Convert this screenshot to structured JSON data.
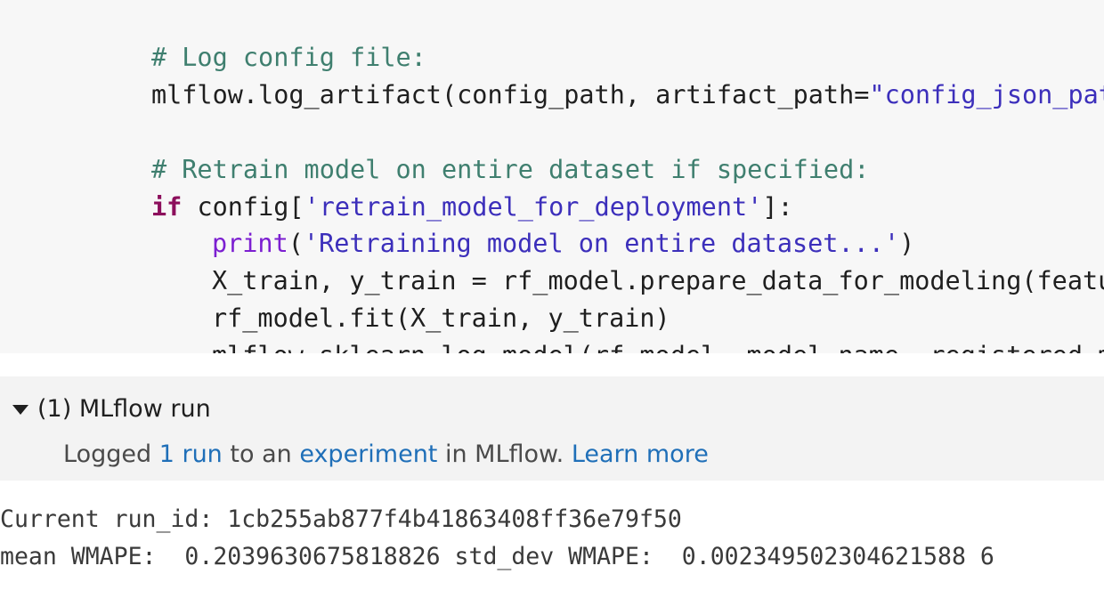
{
  "code": {
    "line1_comment": "# Log config file:",
    "line2_obj": "mlflow.log_artifact(config_path, artifact_path=",
    "line2_str": "\"config_json_path\"",
    "line2_end": ")",
    "line4_comment": "# Retrain model on entire dataset if specified:",
    "line5_kw": "if",
    "line5_a": " config[",
    "line5_str": "'retrain_model_for_deployment'",
    "line5_b": "]:",
    "line6_builtin": "print",
    "line6_a": "(",
    "line6_str": "'Retraining model on entire dataset...'",
    "line6_b": ")",
    "line7": "X_train, y_train = rf_model.prepare_data_for_modeling(features_ut",
    "line8": "rf_model.fit(X_train, y_train)",
    "line9": "mlflow.sklearn.log_model(rf_model, model_name, registered_model_n"
  },
  "mlflow": {
    "header": "(1) MLflow run",
    "logged": "Logged ",
    "run_link": "1 run",
    "to_an": " to an ",
    "experiment_link": "experiment",
    "in_mlflow": " in MLflow. ",
    "learn_more": "Learn more"
  },
  "output": {
    "line1": "Current run_id: 1cb255ab877f4b41863408ff36e79f50",
    "line2": "mean WMAPE:  0.2039630675818826 std_dev WMAPE:  0.002349502304621588 6"
  }
}
